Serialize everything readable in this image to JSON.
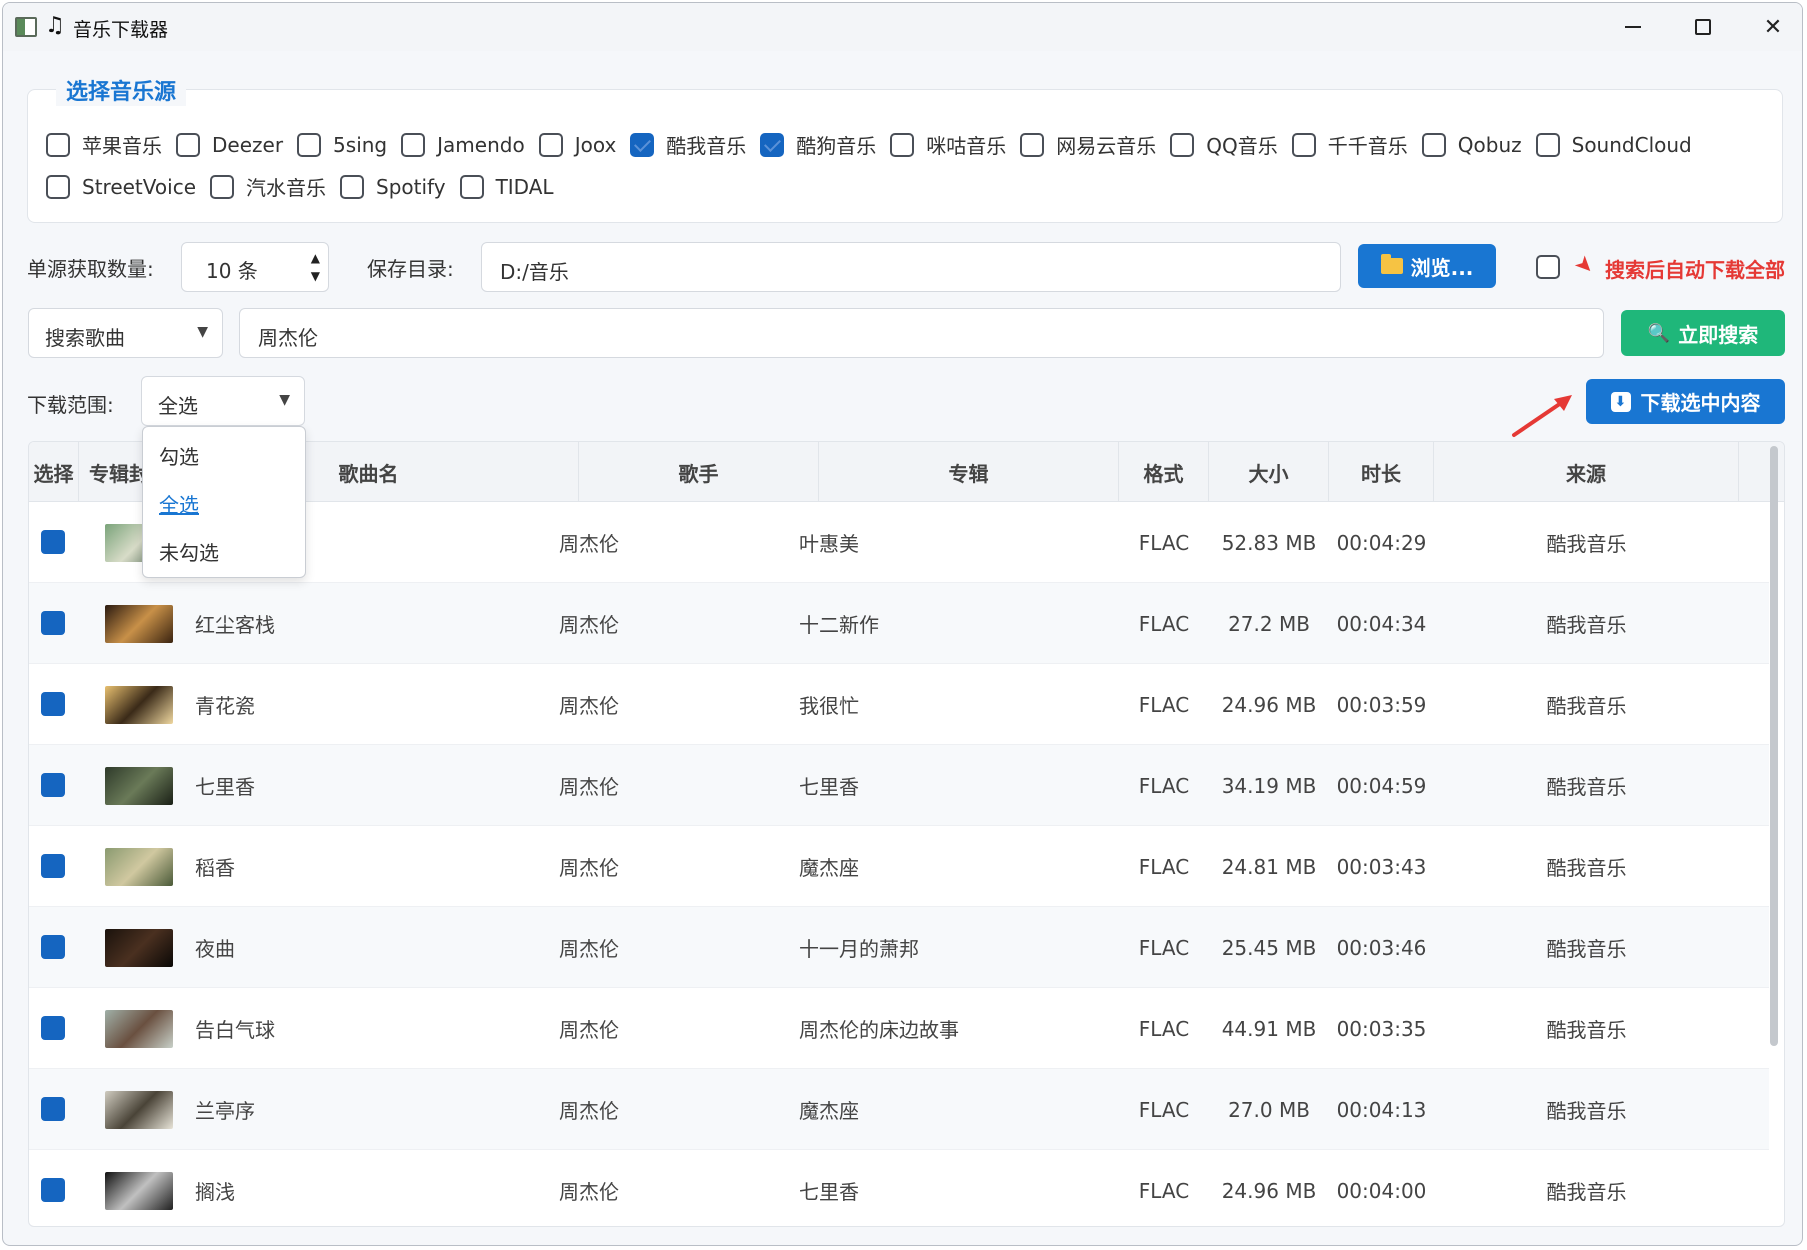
{
  "window": {
    "title": "音乐下载器"
  },
  "sources": {
    "title": "选择音乐源",
    "row1": [
      {
        "label": "苹果音乐",
        "checked": false
      },
      {
        "label": "Deezer",
        "checked": false
      },
      {
        "label": "5sing",
        "checked": false
      },
      {
        "label": "Jamendo",
        "checked": false
      },
      {
        "label": "Joox",
        "checked": false
      },
      {
        "label": "酷我音乐",
        "checked": true
      },
      {
        "label": "酷狗音乐",
        "checked": true
      },
      {
        "label": "咪咕音乐",
        "checked": false
      },
      {
        "label": "网易云音乐",
        "checked": false
      },
      {
        "label": "QQ音乐",
        "checked": false
      },
      {
        "label": "千千音乐",
        "checked": false
      },
      {
        "label": "Qobuz",
        "checked": false
      },
      {
        "label": "SoundCloud",
        "checked": false
      }
    ],
    "row2": [
      {
        "label": "StreetVoice",
        "checked": false
      },
      {
        "label": "汽水音乐",
        "checked": false
      },
      {
        "label": "Spotify",
        "checked": false
      },
      {
        "label": "TIDAL",
        "checked": false
      }
    ]
  },
  "options": {
    "count_label": "单源获取数量:",
    "count_value": "10 条",
    "save_label": "保存目录:",
    "save_path": "D:/音乐",
    "browse_label": "浏览...",
    "auto_download_label": "搜索后自动下载全部",
    "auto_download_checked": false
  },
  "search": {
    "type_value": "搜索歌曲",
    "query": "周杰伦",
    "button_label": "立即搜索"
  },
  "range": {
    "label": "下载范围:",
    "value": "全选",
    "options": [
      "勾选",
      "全选",
      "未勾选"
    ],
    "selected_index": 1,
    "download_button_label": "下载选中内容"
  },
  "table": {
    "headers": [
      "选择",
      "专辑封面",
      "歌曲名",
      "歌手",
      "专辑",
      "格式",
      "大小",
      "时长",
      "来源"
    ],
    "rows": [
      {
        "song": "",
        "artist": "周杰伦",
        "album": "叶惠美",
        "format": "FLAC",
        "size": "52.83 MB",
        "duration": "00:04:29",
        "source": "酷我音乐",
        "checked": true
      },
      {
        "song": "红尘客栈",
        "artist": "周杰伦",
        "album": "十二新作",
        "format": "FLAC",
        "size": "27.2 MB",
        "duration": "00:04:34",
        "source": "酷我音乐",
        "checked": true
      },
      {
        "song": "青花瓷",
        "artist": "周杰伦",
        "album": "我很忙",
        "format": "FLAC",
        "size": "24.96 MB",
        "duration": "00:03:59",
        "source": "酷我音乐",
        "checked": true
      },
      {
        "song": "七里香",
        "artist": "周杰伦",
        "album": "七里香",
        "format": "FLAC",
        "size": "34.19 MB",
        "duration": "00:04:59",
        "source": "酷我音乐",
        "checked": true
      },
      {
        "song": "稻香",
        "artist": "周杰伦",
        "album": "魔杰座",
        "format": "FLAC",
        "size": "24.81 MB",
        "duration": "00:03:43",
        "source": "酷我音乐",
        "checked": true
      },
      {
        "song": "夜曲",
        "artist": "周杰伦",
        "album": "十一月的萧邦",
        "format": "FLAC",
        "size": "25.45 MB",
        "duration": "00:03:46",
        "source": "酷我音乐",
        "checked": true
      },
      {
        "song": "告白气球",
        "artist": "周杰伦",
        "album": "周杰伦的床边故事",
        "format": "FLAC",
        "size": "44.91 MB",
        "duration": "00:03:35",
        "source": "酷我音乐",
        "checked": true
      },
      {
        "song": "兰亭序",
        "artist": "周杰伦",
        "album": "魔杰座",
        "format": "FLAC",
        "size": "27.0 MB",
        "duration": "00:04:13",
        "source": "酷我音乐",
        "checked": true
      },
      {
        "song": "搁浅",
        "artist": "周杰伦",
        "album": "七里香",
        "format": "FLAC",
        "size": "24.96 MB",
        "duration": "00:04:00",
        "source": "酷我音乐",
        "checked": true
      }
    ]
  },
  "colors": {
    "primary": "#1976d2",
    "search_button": "#1fb77a",
    "danger": "#e53935"
  }
}
